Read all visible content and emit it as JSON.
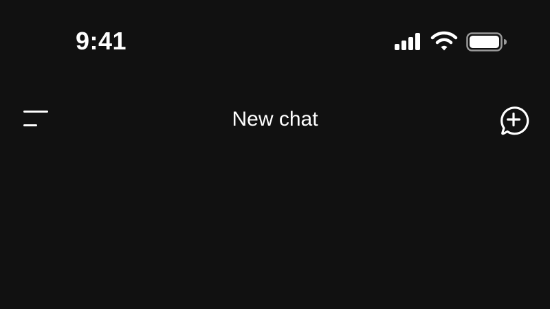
{
  "status_bar": {
    "time": "9:41",
    "icons": [
      "signal-icon",
      "wifi-icon",
      "battery-icon"
    ]
  },
  "nav": {
    "title": "New chat",
    "left_icon": "menu-icon",
    "right_icon": "new-chat-icon"
  },
  "colors": {
    "background": "#111111",
    "foreground": "#ffffff"
  }
}
